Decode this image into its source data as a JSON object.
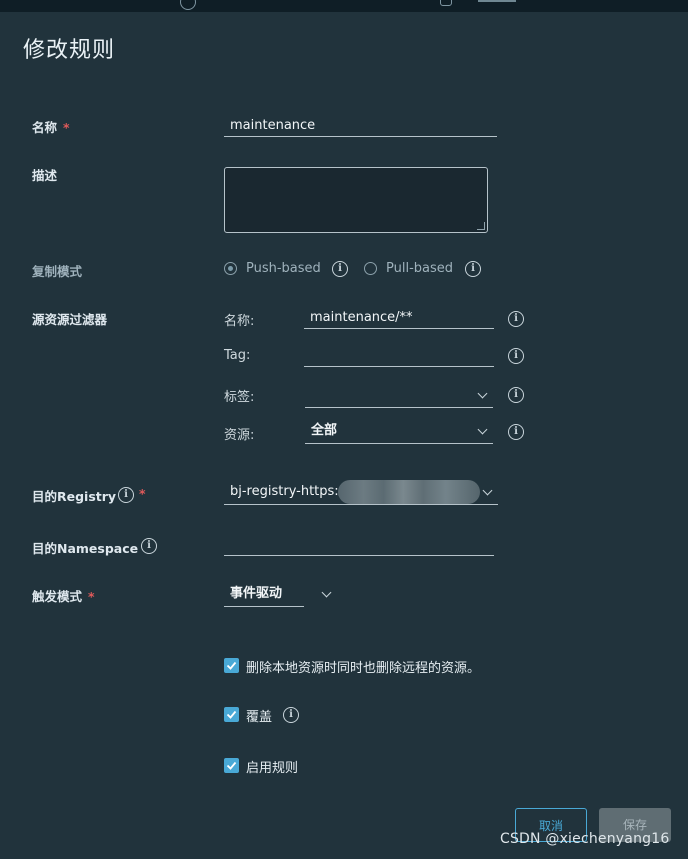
{
  "dialog": {
    "title": "修改规则"
  },
  "fields": {
    "name": {
      "label": "名称",
      "required_mark": "*",
      "value": "maintenance"
    },
    "description": {
      "label": "描述",
      "value": ""
    },
    "replication_mode": {
      "label": "复制模式",
      "options": [
        {
          "label": "Push-based",
          "selected": true
        },
        {
          "label": "Pull-based",
          "selected": false
        }
      ]
    },
    "source_filter": {
      "label": "源资源过滤器",
      "name_label": "名称:",
      "name_value": "maintenance/**",
      "tag_label": "Tag:",
      "tag_value": "",
      "labels_label": "标签:",
      "labels_value": "",
      "resource_label": "资源:",
      "resource_value": "全部"
    },
    "dest_registry": {
      "label": "目的Registry",
      "required_mark": "*",
      "value": "bj-registry-https:/"
    },
    "dest_namespace": {
      "label": "目的Namespace",
      "value": ""
    },
    "trigger_mode": {
      "label": "触发模式",
      "required_mark": "*",
      "value": "事件驱动"
    }
  },
  "options": [
    {
      "label": "删除本地资源时同时也删除远程的资源。",
      "checked": true
    },
    {
      "label": "覆盖",
      "checked": true
    },
    {
      "label": "启用规则",
      "checked": true
    }
  ],
  "buttons": {
    "cancel": "取消",
    "save": "保存"
  },
  "watermark": "CSDN @xiechenyang16",
  "icons": {
    "info": "info-icon",
    "chevron": "chevron-down-icon",
    "check": "check-icon"
  },
  "colors": {
    "background": "#21333c",
    "accent": "#49a9d6",
    "required": "#e05a5a"
  }
}
